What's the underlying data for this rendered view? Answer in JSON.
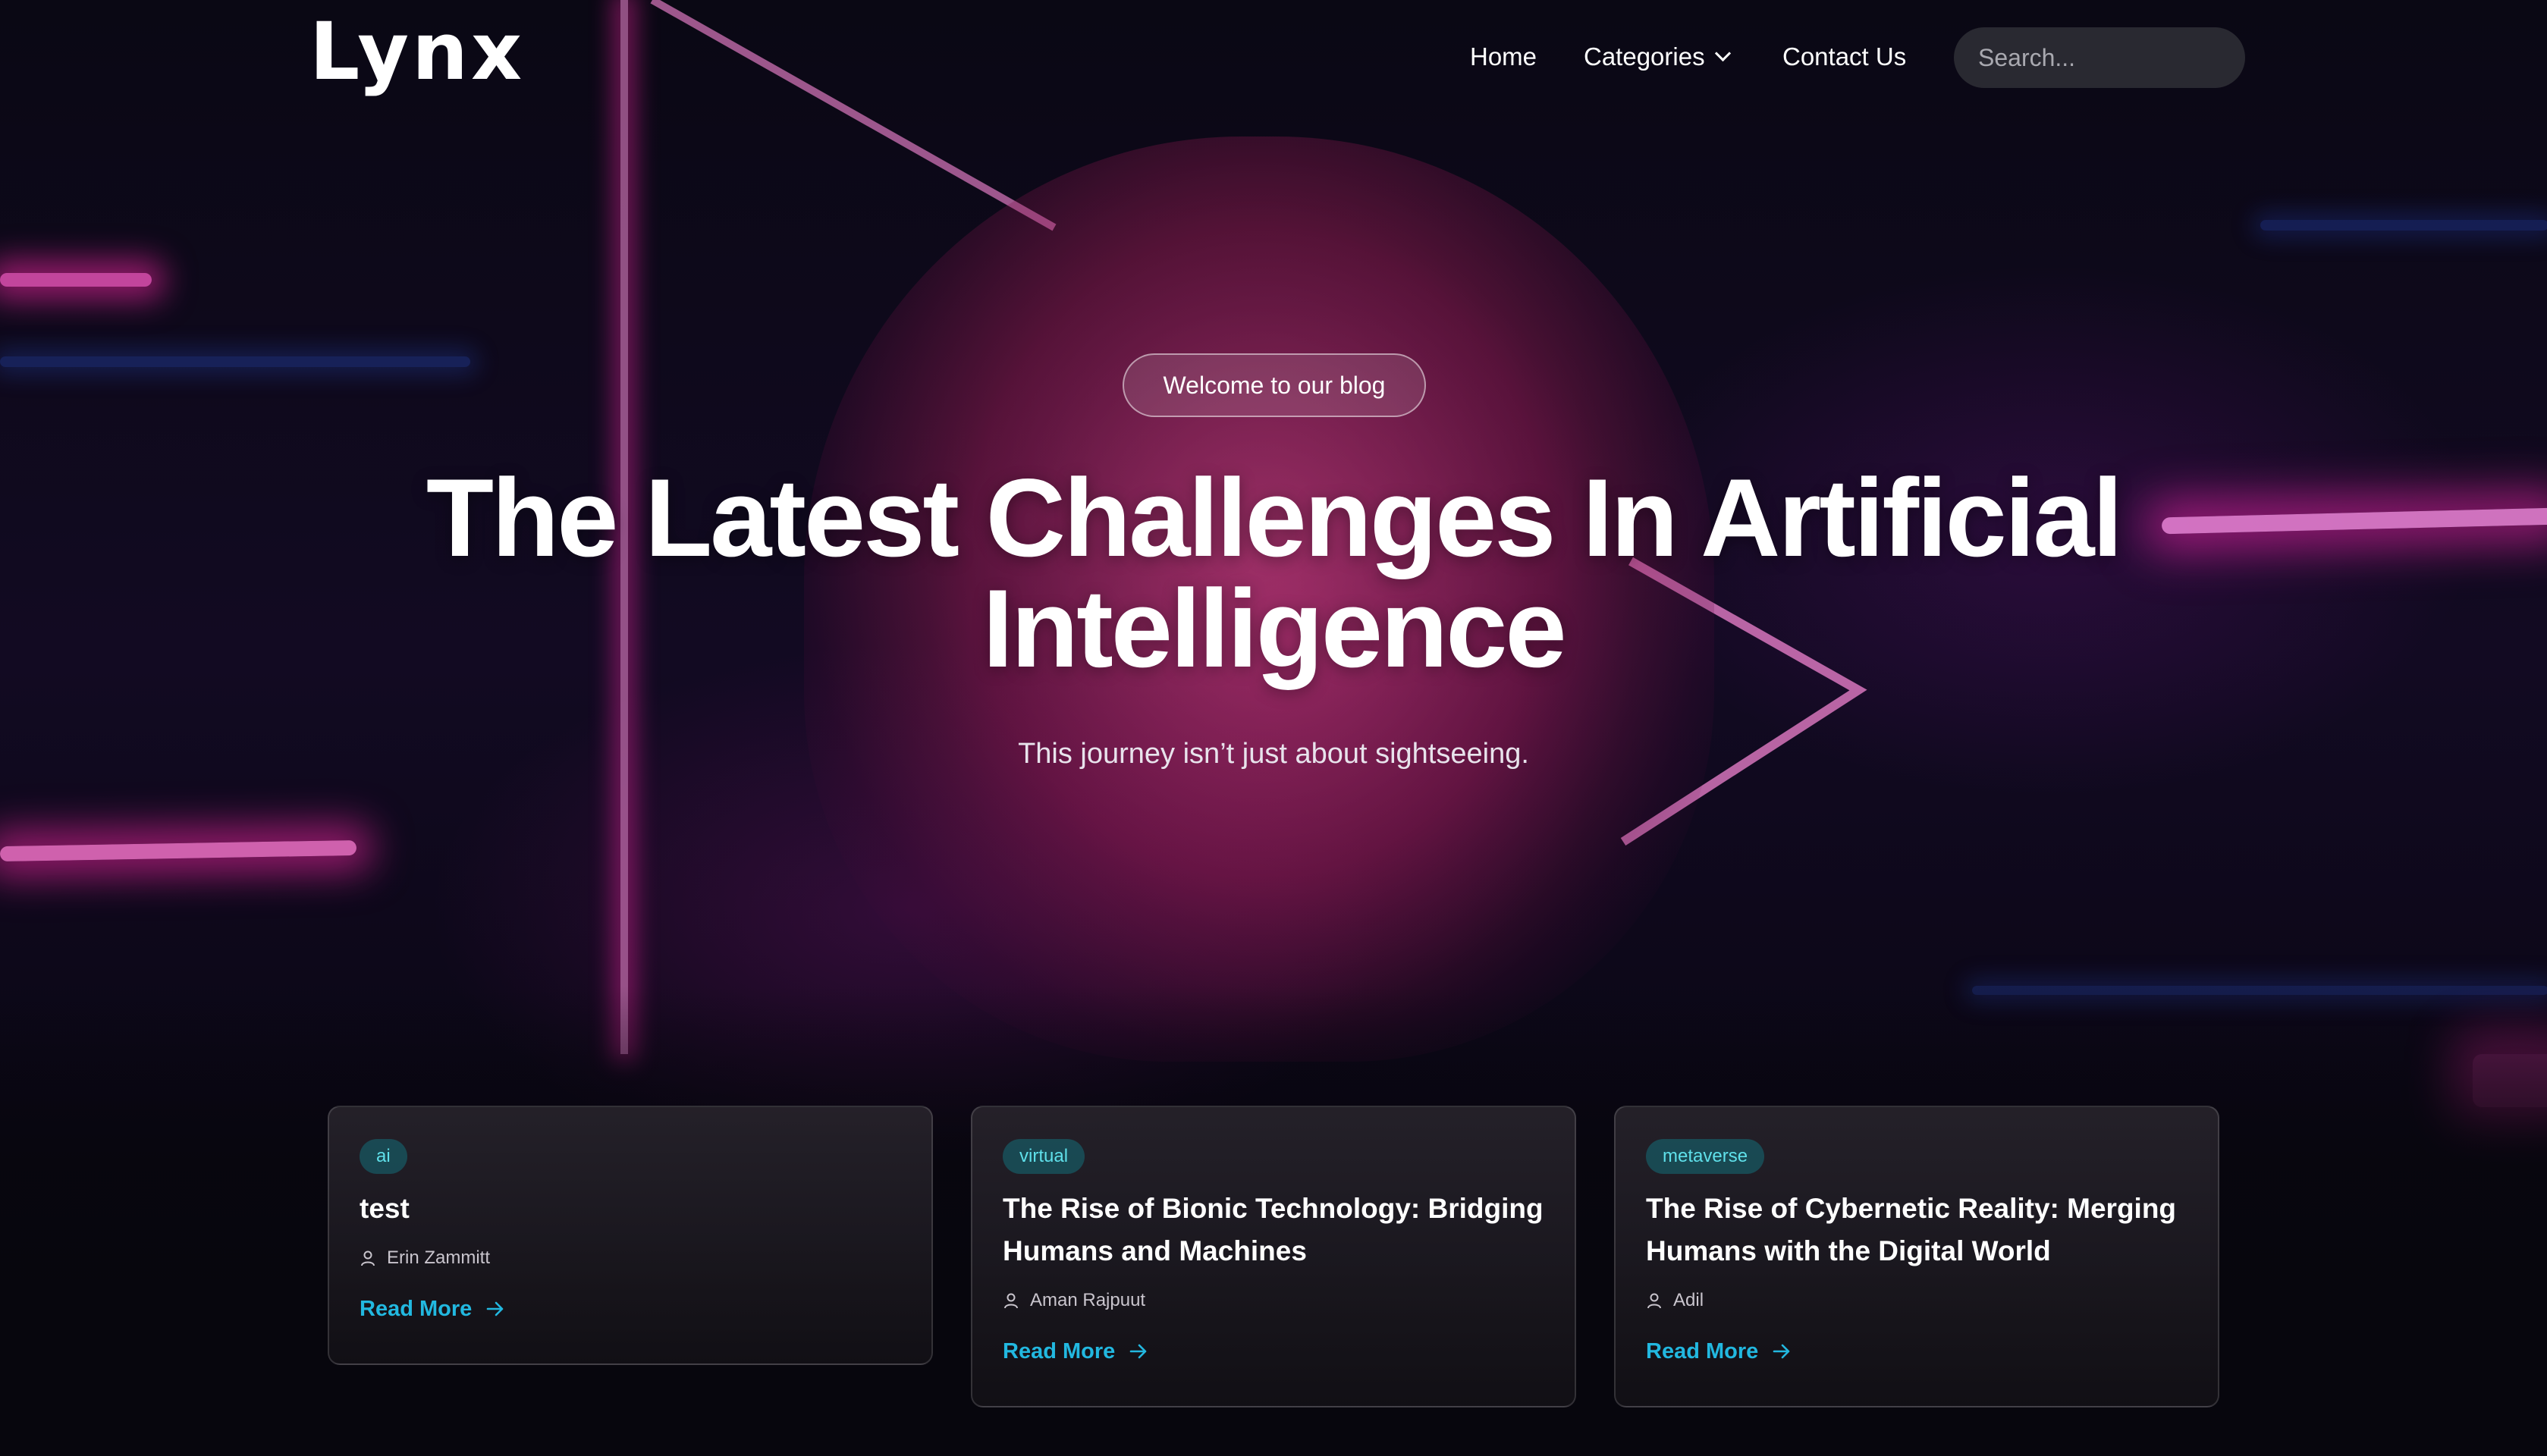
{
  "nav": {
    "logo": "Lynx",
    "home": "Home",
    "categories": "Categories",
    "contact": "Contact Us",
    "search_placeholder": "Search..."
  },
  "hero": {
    "pill": "Welcome to our blog",
    "title_line1": "The Latest Challenges In Artificial",
    "title_line2": "Intelligence",
    "subtitle": "This journey isn’t just about sightseeing."
  },
  "cards": [
    {
      "tag": "ai",
      "title": "test",
      "author": "Erin Zammitt",
      "cta": "Read More"
    },
    {
      "tag": "virtual",
      "title": "The Rise of Bionic Technology: Bridging Humans and Machines",
      "author": "Aman Rajpuut",
      "cta": "Read More"
    },
    {
      "tag": "metaverse",
      "title": "The Rise of Cybernetic Reality: Merging Humans with the Digital World",
      "author": "Adil",
      "cta": "Read More"
    }
  ],
  "colors": {
    "accent": "#22b8e0",
    "tag_text": "#5fe0ea",
    "neon": "#ff3cb4"
  }
}
